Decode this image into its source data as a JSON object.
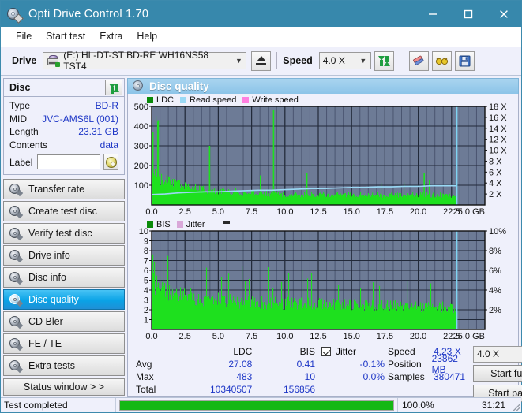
{
  "window": {
    "title": "Opti Drive Control 1.70",
    "minimize": "—",
    "maximize": "☐",
    "close": "✕"
  },
  "menu": {
    "items": [
      "File",
      "Start test",
      "Extra",
      "Help"
    ]
  },
  "toolbar": {
    "drive_label": "Drive",
    "drive_value": "(E:)  HL-DT-ST BD-RE  WH16NS58 TST4",
    "eject_icon": "eject-icon",
    "speed_label": "Speed",
    "speed_value": "4.0 X",
    "refresh_icon": "refresh-icon",
    "erase_icon": "eraser-icon",
    "glasses_icon": "glasses-icon",
    "save_icon": "floppy-save-icon"
  },
  "disc": {
    "header": "Disc",
    "refresh_icon": "refresh-icon",
    "rows": [
      {
        "key": "Type",
        "value": "BD-R"
      },
      {
        "key": "MID",
        "value": "JVC-AMS6L (001)"
      },
      {
        "key": "Length",
        "value": "23.31 GB"
      },
      {
        "key": "Contents",
        "value": "data"
      }
    ],
    "label_key": "Label",
    "label_value": "",
    "label_placeholder": "",
    "label_button_icon": "disc-icon"
  },
  "nav": {
    "items": [
      {
        "label": "Transfer rate",
        "active": false
      },
      {
        "label": "Create test disc",
        "active": false
      },
      {
        "label": "Verify test disc",
        "active": false
      },
      {
        "label": "Drive info",
        "active": false
      },
      {
        "label": "Disc info",
        "active": false
      },
      {
        "label": "Disc quality",
        "active": true
      },
      {
        "label": "CD Bler",
        "active": false
      },
      {
        "label": "FE / TE",
        "active": false
      },
      {
        "label": "Extra tests",
        "active": false
      }
    ],
    "status_window": "Status window > >"
  },
  "main": {
    "title": "Disc quality",
    "title_icon": "disc-quality-icon"
  },
  "stats": {
    "col_headers": [
      "",
      "LDC",
      "BIS"
    ],
    "rows": [
      {
        "label": "Avg",
        "ldc": "27.08",
        "bis": "0.41",
        "jitter": "-0.1%"
      },
      {
        "label": "Max",
        "ldc": "483",
        "bis": "10",
        "jitter": "0.0%"
      },
      {
        "label": "Total",
        "ldc": "10340507",
        "bis": "156856",
        "jitter": ""
      }
    ],
    "jitter_label": "Jitter",
    "jitter_checked": true,
    "speed_key": "Speed",
    "speed_value": "4.23 X",
    "position_key": "Position",
    "position_value": "23862 MB",
    "samples_key": "Samples",
    "samples_value": "380471",
    "speed_select": "4.0 X",
    "start_full": "Start full",
    "start_part": "Start part"
  },
  "statusbar": {
    "message": "Test completed",
    "progress_pct": "100.0%",
    "progress_value": 100,
    "elapsed": "31:21"
  },
  "colors": {
    "accent": "#3788ac",
    "plot_bg": "#6d7b96",
    "ldc_green": "#1ee01e",
    "read_speed": "#9ad9f5",
    "write_speed": "#ff7fe0",
    "jitter_pink": "#d9a8d9",
    "value_blue": "#1d36c6",
    "progress_green": "#14b814"
  },
  "chart_data": [
    {
      "type": "bar",
      "name": "top-chart-ldc",
      "title": "",
      "xlabel": "GB",
      "ylabel": "",
      "legend": [
        {
          "label": "LDC",
          "color": "#0a8a0a"
        },
        {
          "label": "Read speed",
          "color": "#9ad9f5"
        },
        {
          "label": "Write speed",
          "color": "#ff7fe0"
        }
      ],
      "legend_position": "top-left",
      "grid": true,
      "xlim": [
        0.0,
        25.0
      ],
      "xticks": [
        "0.0",
        "2.5",
        "5.0",
        "7.5",
        "10.0",
        "12.5",
        "15.0",
        "17.5",
        "20.0",
        "22.5",
        "25.0 GB"
      ],
      "ylim": [
        0,
        500
      ],
      "yticks": [
        "100",
        "200",
        "300",
        "400",
        "500"
      ],
      "y2lim": [
        0,
        18
      ],
      "y2ticks": [
        "2 X",
        "4 X",
        "6 X",
        "8 X",
        "10 X",
        "12 X",
        "14 X",
        "16 X",
        "18 X"
      ],
      "data_end_x": 22.9,
      "series": [
        {
          "name": "LDC",
          "color": "#1ee01e",
          "x": [
            0.05,
            0.15,
            0.25,
            0.35,
            0.45,
            0.55,
            0.65,
            0.75,
            0.85,
            0.95,
            1.1,
            1.25,
            1.4,
            1.55,
            1.7,
            1.85,
            2.0,
            2.2,
            2.4,
            2.6,
            2.8,
            3.0,
            3.2,
            3.4,
            3.6,
            3.8,
            4.0,
            4.3,
            4.6,
            4.9,
            5.2,
            5.5,
            5.8,
            6.1,
            6.4,
            6.7,
            7.0,
            7.3,
            7.6,
            7.9,
            8.2,
            8.5,
            8.8,
            9.1,
            9.4,
            9.7,
            10.0,
            10.4,
            10.8,
            11.2,
            11.6,
            12.0,
            12.4,
            12.8,
            13.2,
            13.6,
            14.0,
            14.4,
            14.8,
            15.2,
            15.6,
            16.0,
            16.4,
            16.8,
            17.2,
            17.6,
            18.0,
            18.4,
            18.8,
            19.2,
            19.6,
            20.0,
            20.4,
            20.8,
            21.2,
            21.6,
            22.0,
            22.4,
            22.8
          ],
          "values": [
            370,
            150,
            120,
            110,
            430,
            105,
            135,
            100,
            115,
            95,
            150,
            90,
            95,
            85,
            120,
            80,
            85,
            95,
            75,
            80,
            78,
            72,
            75,
            70,
            68,
            72,
            66,
            300,
            65,
            64,
            68,
            62,
            66,
            63,
            62,
            64,
            60,
            62,
            61,
            63,
            60,
            62,
            60,
            480,
            61,
            60,
            62,
            59,
            61,
            60,
            160,
            60,
            62,
            59,
            61,
            60,
            59,
            61,
            60,
            62,
            59,
            61,
            60,
            59,
            61,
            60,
            62,
            59,
            61,
            60,
            62,
            59,
            160,
            61,
            60,
            62,
            59,
            61,
            95
          ]
        },
        {
          "name": "Read speed",
          "color": "#9ad9f5",
          "x": [
            0.0,
            1.0,
            2.0,
            3.0,
            4.0,
            5.0,
            6.0,
            7.0,
            8.0,
            9.0,
            10.0,
            11.0,
            12.0,
            13.0,
            14.0,
            15.0,
            16.0,
            17.0,
            18.0,
            19.0,
            20.0,
            21.0,
            22.0,
            22.9
          ],
          "values": [
            1.9,
            2.0,
            2.2,
            2.3,
            2.4,
            2.4,
            2.5,
            2.6,
            2.7,
            2.7,
            2.8,
            2.9,
            3.0,
            3.0,
            3.1,
            3.2,
            3.2,
            3.3,
            3.3,
            3.4,
            3.4,
            3.5,
            3.5,
            3.5
          ]
        }
      ]
    },
    {
      "type": "bar",
      "name": "bottom-chart-bis",
      "title": "",
      "xlabel": "GB",
      "ylabel": "",
      "legend": [
        {
          "label": "BIS",
          "color": "#0a8a0a"
        },
        {
          "label": "Jitter",
          "color": "#d9a8d9"
        }
      ],
      "legend_position": "top-left",
      "grid": true,
      "xlim": [
        0.0,
        25.0
      ],
      "xticks": [
        "0.0",
        "2.5",
        "5.0",
        "7.5",
        "10.0",
        "12.5",
        "15.0",
        "17.5",
        "20.0",
        "22.5",
        "25.0 GB"
      ],
      "ylim": [
        0,
        10
      ],
      "yticks": [
        "1",
        "2",
        "3",
        "4",
        "5",
        "6",
        "7",
        "8",
        "9",
        "10"
      ],
      "y2lim": [
        0,
        10
      ],
      "y2ticks": [
        "2%",
        "4%",
        "6%",
        "8%",
        "10%"
      ],
      "data_end_x": 22.9,
      "series": [
        {
          "name": "BIS",
          "color": "#1ee01e",
          "baseline": 3,
          "note": "dense bars mostly 2-4 with frequent spikes to 5-7 and occasional 9-10"
        }
      ]
    }
  ]
}
